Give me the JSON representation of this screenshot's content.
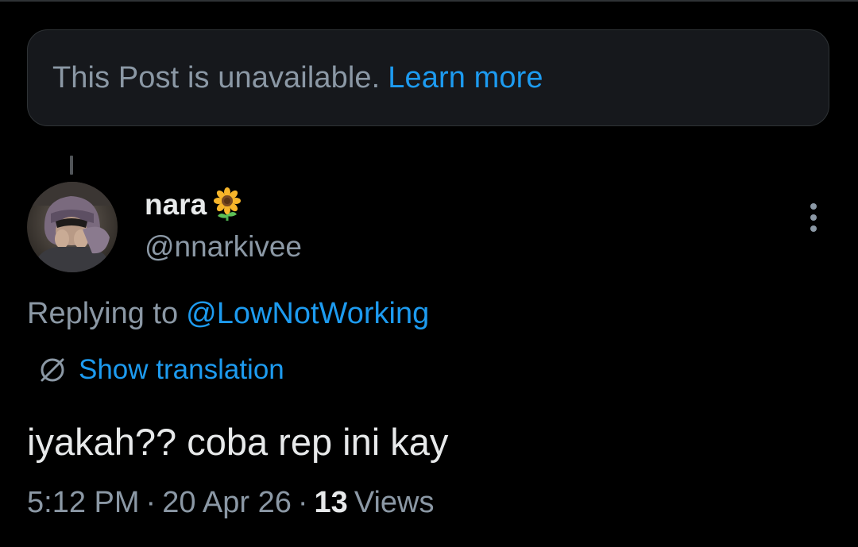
{
  "colors": {
    "background": "#000000",
    "card_background": "#16181c",
    "border": "#2f3336",
    "primary_text": "#e7e9ea",
    "secondary_text": "#8b98a5",
    "accent_link": "#1d9bf0"
  },
  "unavailable_notice": {
    "text": "This Post is unavailable.",
    "link_label": "Learn more"
  },
  "author": {
    "display_name": "nara",
    "name_emoji_icon": "sunflower-icon",
    "handle": "@nnarkivee",
    "avatar_icon": "avatar-photo"
  },
  "more_menu_icon": "more-vertical-icon",
  "reply_context": {
    "prefix": "Replying to",
    "target_handle": "@LowNotWorking"
  },
  "translation": {
    "icon": "translate-globe-icon",
    "label": "Show translation"
  },
  "post": {
    "text": "iyakah?? coba rep ini kay"
  },
  "meta": {
    "time": "5:12 PM",
    "date": "20 Apr 26",
    "separator": "·",
    "views_count": "13",
    "views_label": "Views"
  }
}
